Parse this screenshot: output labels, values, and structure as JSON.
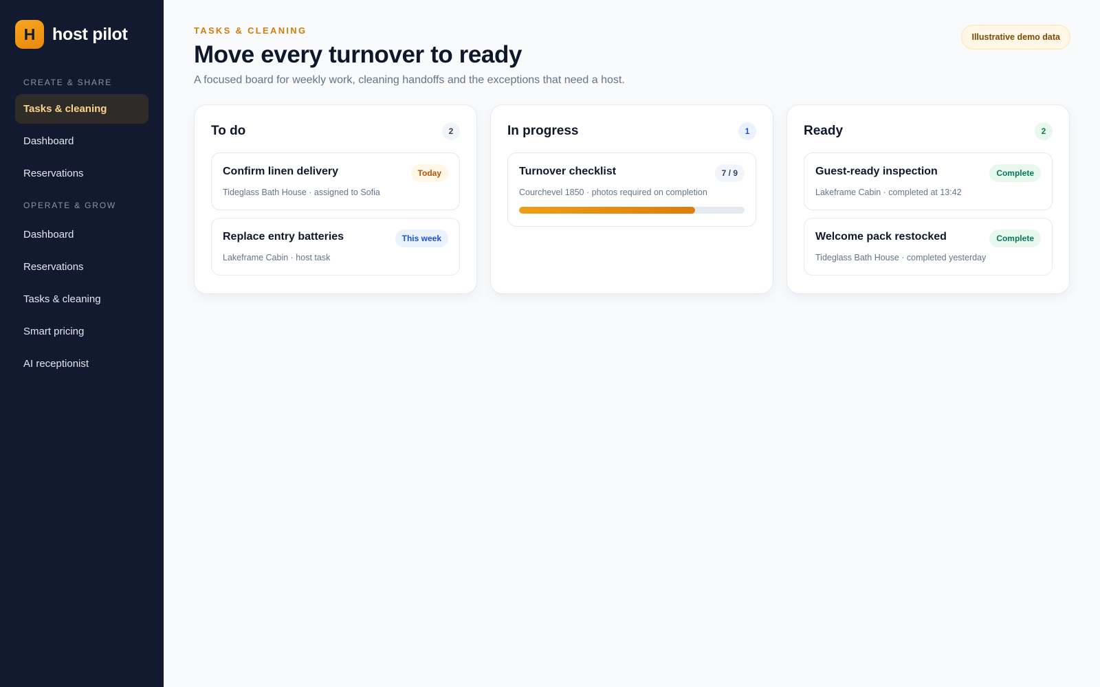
{
  "brand": {
    "mark": "H",
    "name": "host pilot"
  },
  "sidebar": {
    "groups": [
      {
        "label": "CREATE & SHARE",
        "items": [
          {
            "label": "Tasks & cleaning",
            "active": true
          },
          {
            "label": "Dashboard"
          },
          {
            "label": "Reservations"
          }
        ]
      },
      {
        "label": "OPERATE & GROW",
        "items": [
          {
            "label": "Dashboard"
          },
          {
            "label": "Reservations"
          },
          {
            "label": "Tasks & cleaning"
          },
          {
            "label": "Smart pricing"
          },
          {
            "label": "AI receptionist"
          }
        ]
      }
    ]
  },
  "header": {
    "eyebrow": "TASKS & CLEANING",
    "title": "Move every turnover to ready",
    "subtitle": "A focused board for weekly work, cleaning handoffs and the exceptions that need a host.",
    "badge": "Illustrative demo data"
  },
  "board": {
    "columns": [
      {
        "title": "To do",
        "count": "2",
        "cards": [
          {
            "title": "Confirm linen delivery",
            "pill": "Today",
            "meta": "Tideglass Bath House · assigned to Sofia"
          },
          {
            "title": "Replace entry batteries",
            "pill": "This week",
            "meta": "Lakeframe Cabin · host task"
          }
        ]
      },
      {
        "title": "In progress",
        "count": "1",
        "cards": [
          {
            "title": "Turnover checklist",
            "pill": "7 / 9",
            "meta": "Courchevel 1850 · photos required on completion",
            "progress": 0.78
          }
        ]
      },
      {
        "title": "Ready",
        "count": "2",
        "cards": [
          {
            "title": "Guest-ready inspection",
            "pill": "Complete",
            "meta": "Lakeframe Cabin · completed at 13:42"
          },
          {
            "title": "Welcome pack restocked",
            "pill": "Complete",
            "meta": "Tideglass Bath House · completed yesterday"
          }
        ]
      }
    ]
  },
  "colors": {
    "sidebar_bg": "#111a2e",
    "accent": "#f09e16",
    "active_nav_text": "#fbd68a",
    "page_bg": "#f8fafc"
  }
}
